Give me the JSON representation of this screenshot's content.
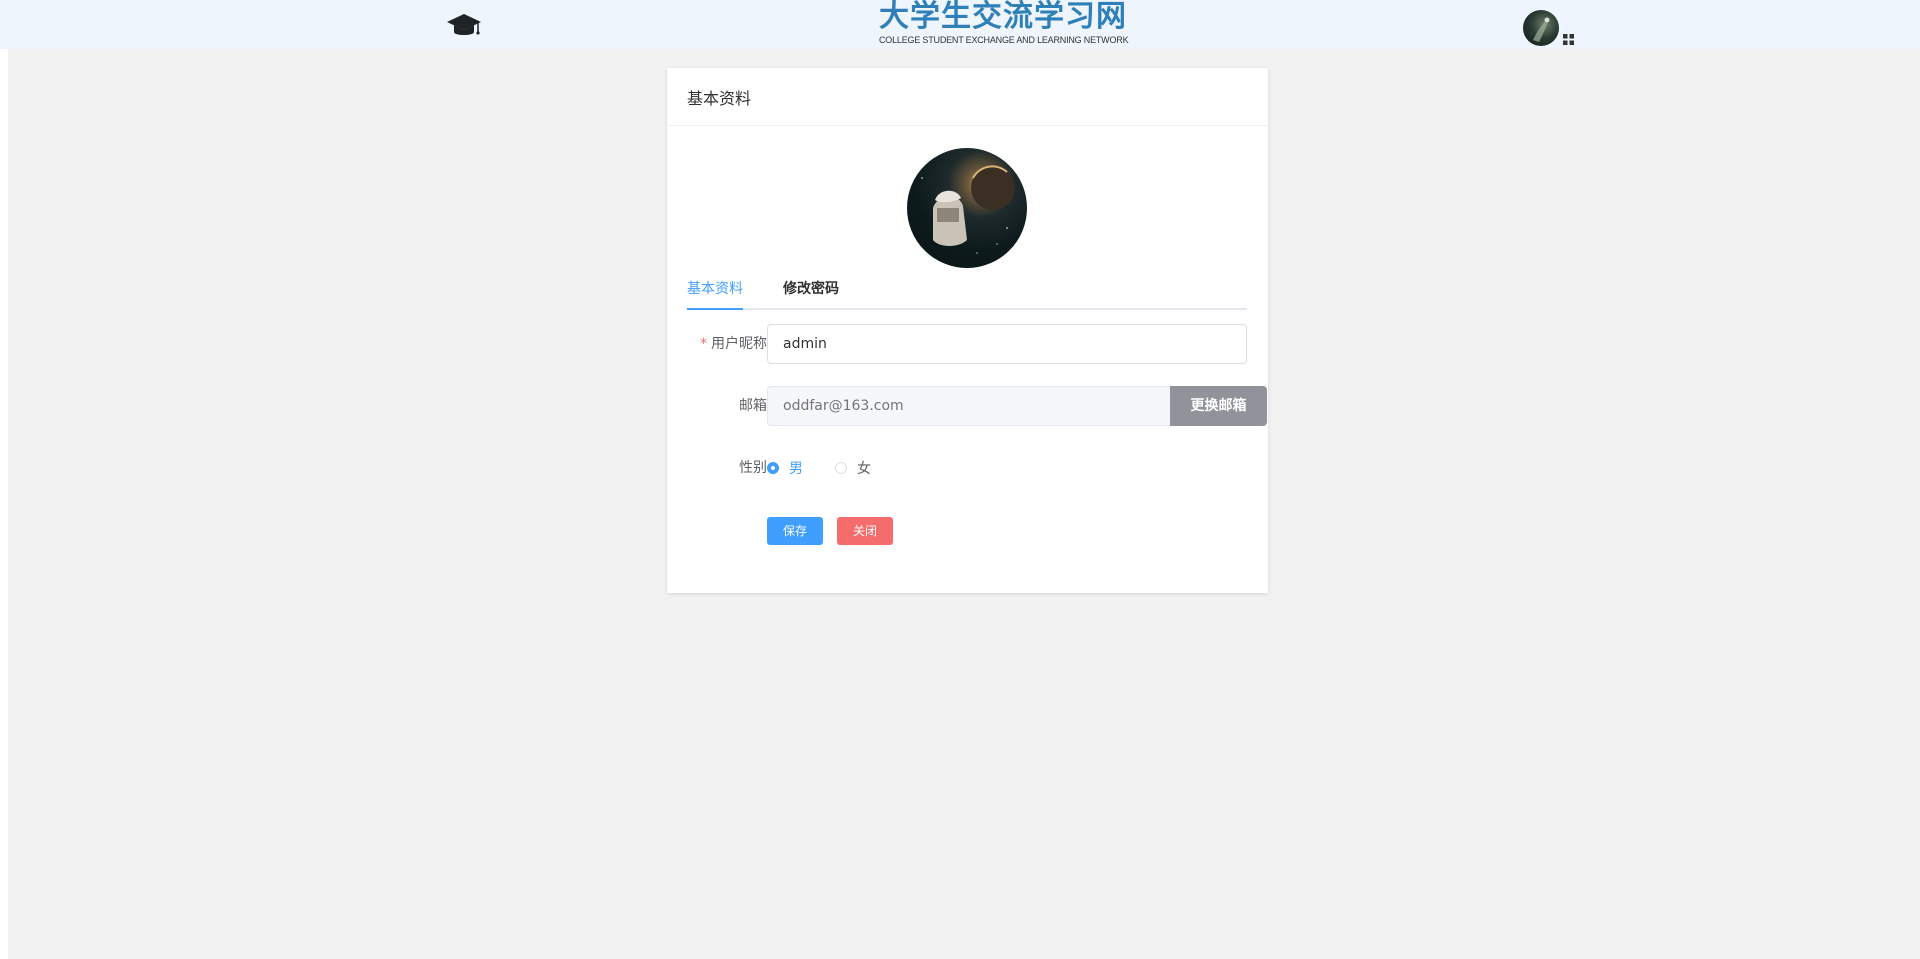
{
  "header": {
    "logo_title": "大学生交流学习网",
    "logo_subtitle": "COLLEGE STUDENT EXCHANGE AND LEARNING NETWORK",
    "cap_icon": "graduation-cap-icon",
    "user_avatar_alt": "user avatar",
    "menu_icon": "grid-menu-icon"
  },
  "card": {
    "title": "基本资料",
    "tabs": [
      {
        "label": "基本资料",
        "active": true
      },
      {
        "label": "修改密码",
        "active": false
      }
    ],
    "form": {
      "nickname": {
        "label": "用户昵称",
        "required_mark": "*",
        "value": "admin"
      },
      "email": {
        "label": "邮箱",
        "placeholder": "oddfar@163.com",
        "change_button": "更换邮箱"
      },
      "gender": {
        "label": "性别",
        "options": [
          {
            "label": "男",
            "checked": true
          },
          {
            "label": "女",
            "checked": false
          }
        ]
      },
      "save_button": "保存",
      "close_button": "关闭"
    }
  },
  "colors": {
    "primary": "#409eff",
    "danger": "#f56c6c",
    "info": "#909399",
    "header_bg": "#eef5fc",
    "logo_blue": "#2f7fb8"
  }
}
